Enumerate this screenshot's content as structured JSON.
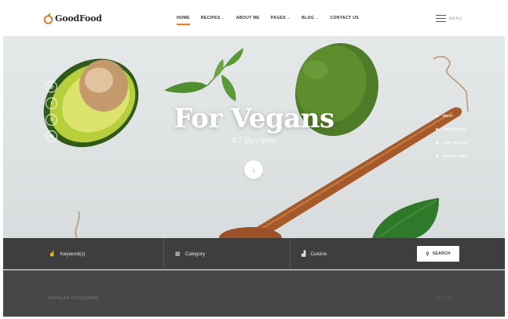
{
  "brand": {
    "name": "GoodFood",
    "accent": "#e07b2f"
  },
  "nav": {
    "items": [
      {
        "label": "HOME",
        "active": true,
        "dropdown": false
      },
      {
        "label": "RECIPES",
        "active": false,
        "dropdown": true
      },
      {
        "label": "ABOUT ME",
        "active": false,
        "dropdown": false
      },
      {
        "label": "PAGES",
        "active": false,
        "dropdown": true
      },
      {
        "label": "BLOG",
        "active": false,
        "dropdown": true
      },
      {
        "label": "CONTACT US",
        "active": false,
        "dropdown": false
      }
    ],
    "caret": "⌄",
    "menu_label": "MENU"
  },
  "hero": {
    "title": "For Vegans",
    "subtitle": "67 Recipes",
    "scroll_icon": "↓",
    "social": [
      "instagram-icon",
      "facebook-icon",
      "pinterest-icon",
      "mail-icon"
    ],
    "social_glyphs": [
      "◎",
      "f",
      "℗",
      "✉"
    ],
    "categories": [
      {
        "label": "MEAT",
        "active": false
      },
      {
        "label": "SMOOTHIES",
        "active": false
      },
      {
        "label": "FOR VEGANS",
        "active": true
      },
      {
        "label": "SUGAR FREE",
        "active": false
      }
    ]
  },
  "search": {
    "keyword": {
      "icon": "☝",
      "label": "Keyword(s)"
    },
    "category": {
      "icon": "▦",
      "label": "Category"
    },
    "cuisine": {
      "icon": "▟",
      "label": "Cuisine"
    },
    "button": {
      "icon": "⚲",
      "label": "SEARCH"
    }
  },
  "popular": {
    "label": "POPULAR CATEGORIES",
    "view_all": "VIEW ALL"
  }
}
